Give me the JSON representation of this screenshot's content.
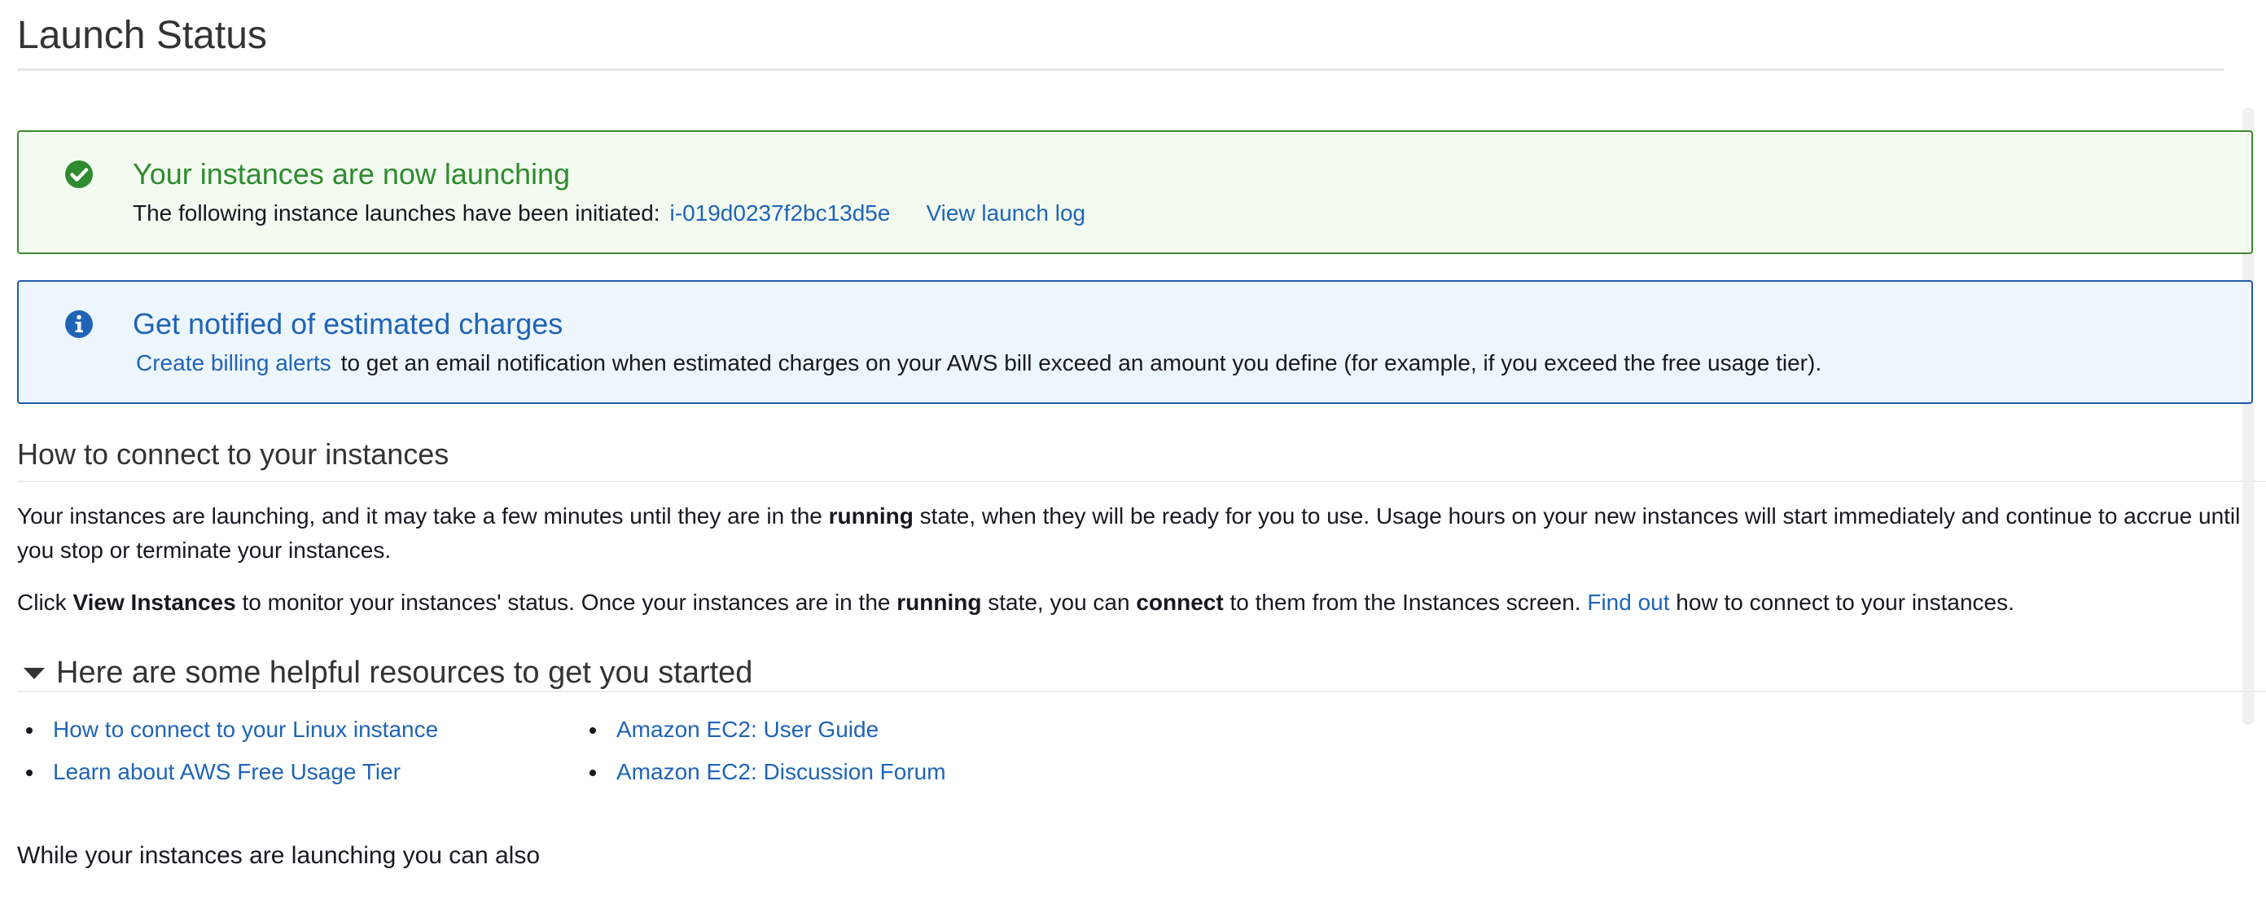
{
  "page": {
    "title": "Launch Status"
  },
  "success_alert": {
    "title": "Your instances are now launching",
    "body_text": "The following instance launches have been initiated:",
    "instance_id": "i-019d0237f2bc13d5e",
    "view_log_label": "View launch log",
    "icon": "check-circle-icon",
    "color": "#2e8b2e"
  },
  "info_alert": {
    "title": "Get notified of estimated charges",
    "link_label": "Create billing alerts",
    "body_text": "to get an email notification when estimated charges on your AWS bill exceed an amount you define (for example, if you exceed the free usage tier).",
    "icon": "info-circle-icon",
    "color": "#1f64b7"
  },
  "connect": {
    "heading": "How to connect to your instances",
    "para1": {
      "part1": "Your instances are launching, and it may take a few minutes until they are in the ",
      "bold1": "running",
      "part2": " state, when they will be ready for you to use. Usage hours on your new instances will start immediately and continue to accrue until you stop or terminate your instances."
    },
    "para2": {
      "part1": "Click ",
      "bold1": "View Instances",
      "part2": " to monitor your instances' status. Once your instances are in the ",
      "bold2": "running",
      "part3": " state, you can ",
      "bold3": "connect",
      "part4": " to them from the Instances screen. ",
      "link": "Find out",
      "part5": " how to connect to your instances."
    }
  },
  "resources": {
    "heading": "Here are some helpful resources to get you started",
    "col1": [
      "How to connect to your Linux instance",
      "Learn about AWS Free Usage Tier"
    ],
    "col2": [
      "Amazon EC2: User Guide",
      "Amazon EC2: Discussion Forum"
    ]
  },
  "footer": {
    "text": "While your instances are launching you can also"
  }
}
